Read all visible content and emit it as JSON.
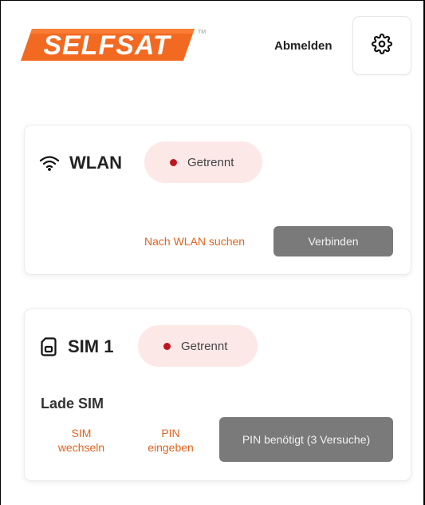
{
  "header": {
    "logo_text": "SELFSAT",
    "trademark": "TM",
    "logout_label": "Abmelden",
    "settings_icon": "gear-icon"
  },
  "wlan": {
    "icon": "wifi-icon",
    "title": "WLAN",
    "status": "Getrennt",
    "scan_label": "Nach WLAN suchen",
    "connect_label": "Verbinden"
  },
  "sim": {
    "icon": "sim-card-icon",
    "title": "SIM 1",
    "status": "Getrennt",
    "loading_text": "Lade SIM",
    "switch_label_1": "SIM",
    "switch_label_2": "wechseln",
    "pin_enter_label_1": "PIN",
    "pin_enter_label_2": "eingeben",
    "pin_needed_label": "PIN benötigt (3 Versuche)"
  },
  "colors": {
    "brand_orange": "#e2631f",
    "status_red": "#c0151e",
    "status_pill_bg": "#fde8e8",
    "disabled_button": "#7a7a7a"
  }
}
